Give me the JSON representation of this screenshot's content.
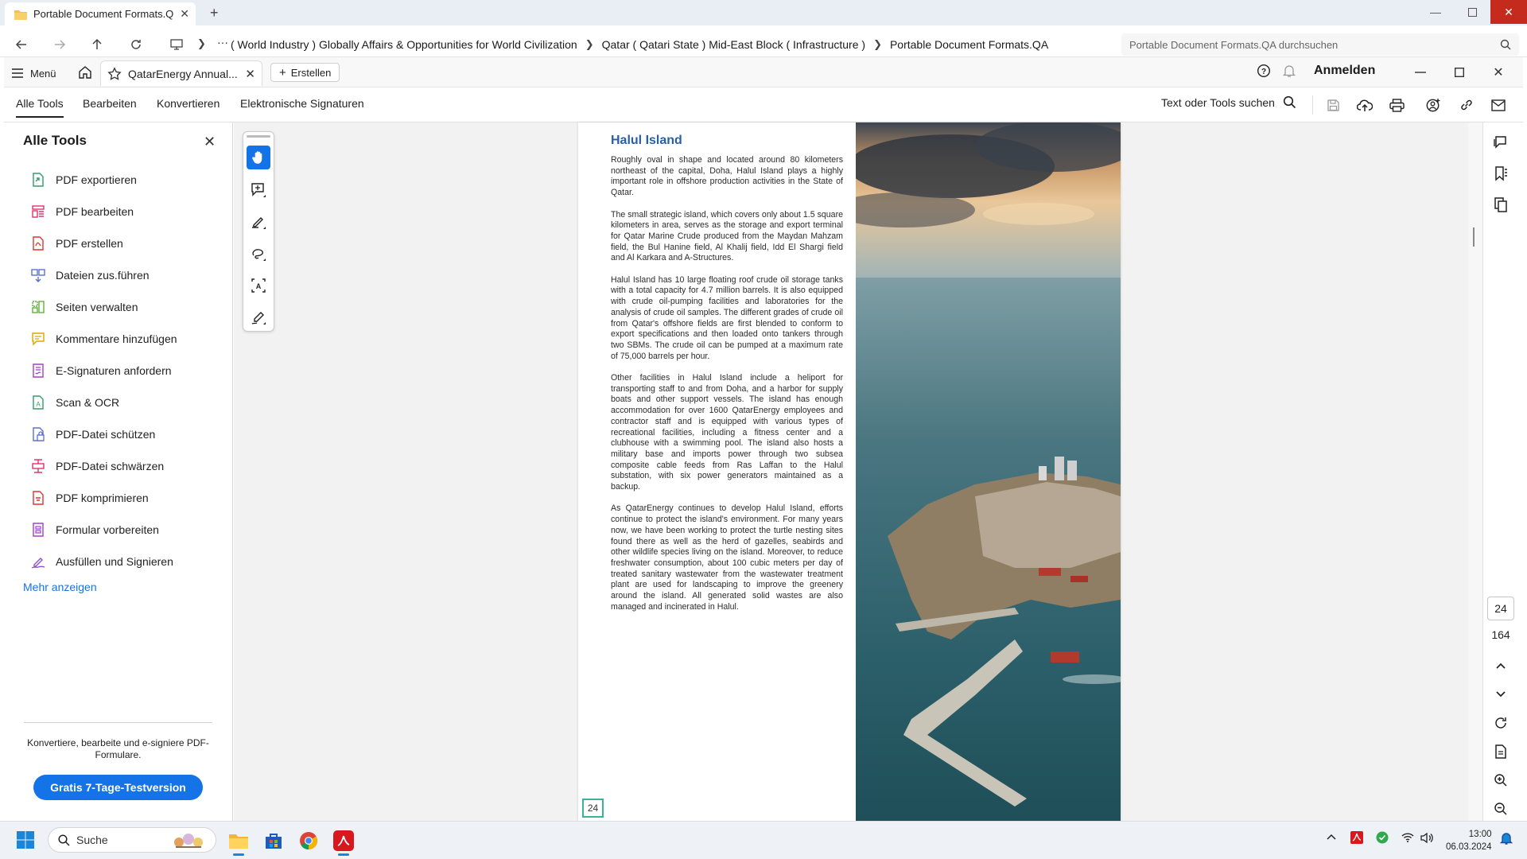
{
  "explorer": {
    "tab_title": "Portable Document Formats.Q",
    "breadcrumb": [
      "( World Industry ) Globally Affairs & Opportunities for World Civilization",
      "Qatar ( Qatari State ) Mid-East Block ( Infrastructure )",
      "Portable Document Formats.QA"
    ],
    "search_placeholder": "Portable Document Formats.QA durchsuchen",
    "more_label": "···"
  },
  "acrobat": {
    "menu_label": "Menü",
    "doc_tab_label": "QatarEnergy Annual...",
    "create_label": "Erstellen",
    "signin_label": "Anmelden",
    "menu_tabs": [
      "Alle Tools",
      "Bearbeiten",
      "Konvertieren",
      "Elektronische Signaturen"
    ],
    "tools_search_label": "Text oder Tools suchen"
  },
  "tools_panel": {
    "title": "Alle Tools",
    "items": [
      {
        "label": "PDF exportieren",
        "icon": "export-pdf-icon",
        "color": "#2e9e6b"
      },
      {
        "label": "PDF bearbeiten",
        "icon": "edit-pdf-icon",
        "color": "#e0336c"
      },
      {
        "label": "PDF erstellen",
        "icon": "create-pdf-icon",
        "color": "#e3342f"
      },
      {
        "label": "Dateien zus.führen",
        "icon": "combine-files-icon",
        "color": "#5b6fd6"
      },
      {
        "label": "Seiten verwalten",
        "icon": "organize-pages-icon",
        "color": "#5fb03b"
      },
      {
        "label": "Kommentare hinzufügen",
        "icon": "comment-icon",
        "color": "#e2a500"
      },
      {
        "label": "E-Signaturen anfordern",
        "icon": "request-signature-icon",
        "color": "#a13fd1"
      },
      {
        "label": "Scan & OCR",
        "icon": "scan-ocr-icon",
        "color": "#2e9e6b"
      },
      {
        "label": "PDF-Datei schützen",
        "icon": "protect-pdf-icon",
        "color": "#5b6fd6"
      },
      {
        "label": "PDF-Datei schwärzen",
        "icon": "redact-pdf-icon",
        "color": "#e0336c"
      },
      {
        "label": "PDF komprimieren",
        "icon": "compress-pdf-icon",
        "color": "#e3342f"
      },
      {
        "label": "Formular vorbereiten",
        "icon": "prepare-form-icon",
        "color": "#a13fd1"
      },
      {
        "label": "Ausfüllen und Signieren",
        "icon": "fill-sign-icon",
        "color": "#8e4fd8"
      }
    ],
    "show_more": "Mehr anzeigen",
    "promo_text": "Konvertiere, bearbeite und e-signiere PDF-Formulare.",
    "trial_button": "Gratis 7-Tage-Testversion"
  },
  "document": {
    "heading": "Halul Island",
    "paragraphs": [
      "Roughly oval in shape and located around 80 kilometers northeast of the capital, Doha, Halul Island plays a highly important role in offshore production activities in the State of Qatar.",
      "The small strategic island, which covers only about 1.5 square kilometers in area, serves as the storage and export terminal for Qatar Marine Crude produced from the Maydan Mahzam field, the Bul Hanine field, Al Khalij field, Idd El Shargi field and Al Karkara and A-Structures.",
      "Halul Island has 10 large floating roof crude oil storage tanks with a total capacity for 4.7 million barrels. It is also equipped with crude oil-pumping facilities and laboratories for the analysis of crude oil samples. The different grades of crude oil from Qatar's offshore fields are first blended to conform to export specifications and then loaded onto tankers through two SBMs. The crude oil can be pumped at a maximum rate of 75,000 barrels per hour.",
      "Other facilities in Halul Island include a heliport for transporting staff to and from Doha, and a harbor for supply boats and other support vessels. The island has enough accommodation for over 1600 QatarEnergy employees and contractor staff and is equipped with various types of recreational facilities, including a fitness center and a clubhouse with a swimming pool. The island also hosts a military base and imports power through two subsea composite cable feeds from Ras Laffan to the Halul substation, with six power generators maintained as a backup.",
      "As QatarEnergy continues to develop Halul Island, efforts continue to protect the island's environment. For many years now, we have been working to protect the turtle nesting sites found there as well as the herd of gazelles, seabirds and other wildlife species living on the island. Moreover, to reduce freshwater consumption, about 100 cubic meters per day of treated sanitary wastewater from the wastewater treatment plant are used for landscaping to improve the greenery around the island. All generated solid wastes are also managed and incinerated in Halul."
    ],
    "page_number_label": "24"
  },
  "page_nav": {
    "current": "24",
    "total": "164"
  },
  "taskbar": {
    "search_label": "Suche",
    "time": "13:00",
    "date": "06.03.2024"
  },
  "colors": {
    "accent": "#1473e6",
    "heading": "#2a5fa4",
    "page_marker": "#3ab39a"
  }
}
